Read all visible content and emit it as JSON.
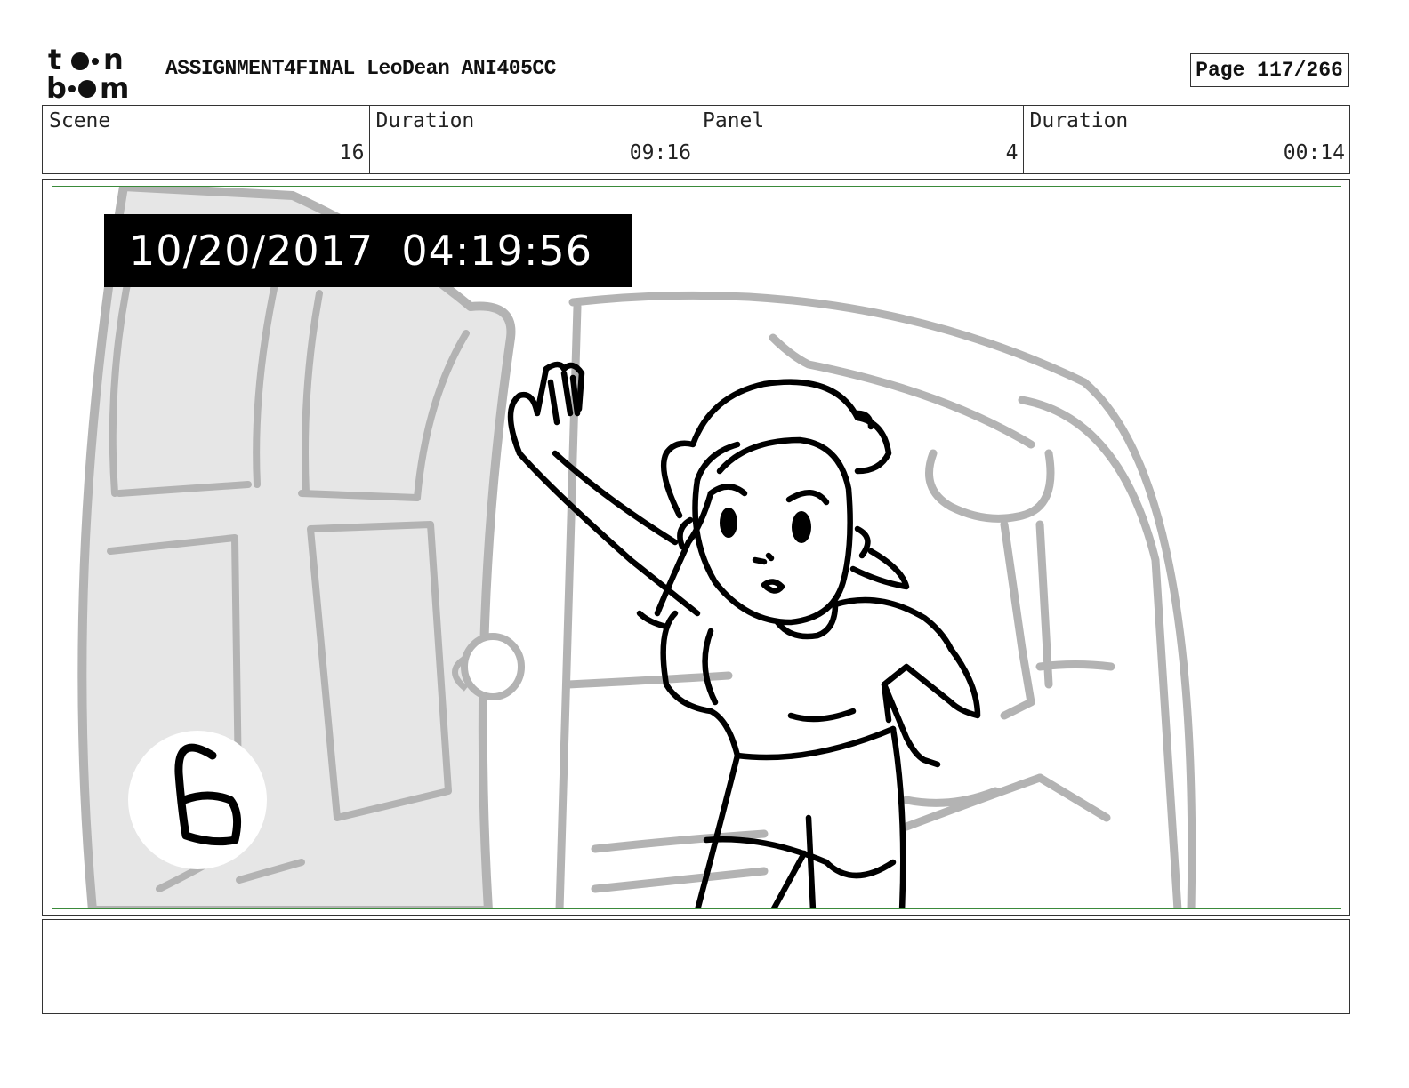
{
  "header": {
    "brand": "toon boom",
    "title": "ASSIGNMENT4FINAL LeoDean ANI405CC",
    "page": "Page 117/266"
  },
  "info": [
    {
      "label": "Scene",
      "value": "16"
    },
    {
      "label": "Duration",
      "value": "09:16"
    },
    {
      "label": "Panel",
      "value": "4"
    },
    {
      "label": "Duration",
      "value": "00:14"
    }
  ],
  "panel": {
    "timestamp": "10/20/2017  04:19:56",
    "badge_number": "6",
    "colors": {
      "frame": "#3a8a3a",
      "sketch_gray": "#b3b3b3",
      "door_fill": "#e6e6e6",
      "ink": "#000000"
    }
  },
  "notes": {
    "text": ""
  }
}
